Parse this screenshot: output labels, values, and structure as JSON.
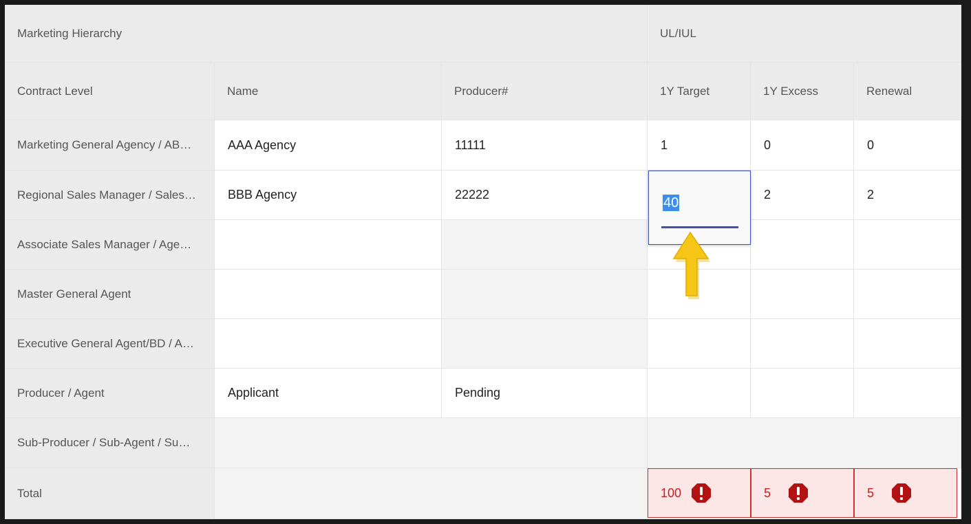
{
  "header": {
    "marketing_hierarchy": "Marketing Hierarchy",
    "product": "UL/IUL",
    "columns": {
      "contract_level": "Contract Level",
      "name": "Name",
      "producer_no": "Producer#",
      "target_1y": "1Y Target",
      "excess_1y": "1Y Excess",
      "renewal": "Renewal"
    }
  },
  "rows": [
    {
      "level": "Marketing General Agency / AB…",
      "name": "AAA Agency",
      "producer": "11111",
      "target": "1",
      "excess": "0",
      "renewal": "0"
    },
    {
      "level": "Regional Sales Manager / Sales…",
      "name": "BBB Agency",
      "producer": "22222",
      "target": "40",
      "excess": "2",
      "renewal": "2"
    },
    {
      "level": "Associate Sales Manager / Age…",
      "name": "",
      "producer": "",
      "target": "",
      "excess": "",
      "renewal": ""
    },
    {
      "level": "Master General Agent",
      "name": "",
      "producer": "",
      "target": "",
      "excess": "",
      "renewal": ""
    },
    {
      "level": "Executive General Agent/BD / A…",
      "name": "",
      "producer": "",
      "target": "",
      "excess": "",
      "renewal": ""
    },
    {
      "level": "Producer / Agent",
      "name": "Applicant",
      "producer": "Pending",
      "target": "",
      "excess": "",
      "renewal": ""
    },
    {
      "level": "Sub-Producer / Sub-Agent / Su…",
      "name": "",
      "producer": "",
      "target": "",
      "excess": "",
      "renewal": ""
    }
  ],
  "total": {
    "label": "Total",
    "target": "100",
    "excess": "5",
    "renewal": "5"
  },
  "icons": {
    "error": "exclamation-octagon-icon",
    "pointer": "yellow-arrow-icon"
  },
  "colors": {
    "error": "#b31212",
    "selection": "#3d8dea",
    "focus": "#3f51b5",
    "arrow": "#f5c518"
  }
}
